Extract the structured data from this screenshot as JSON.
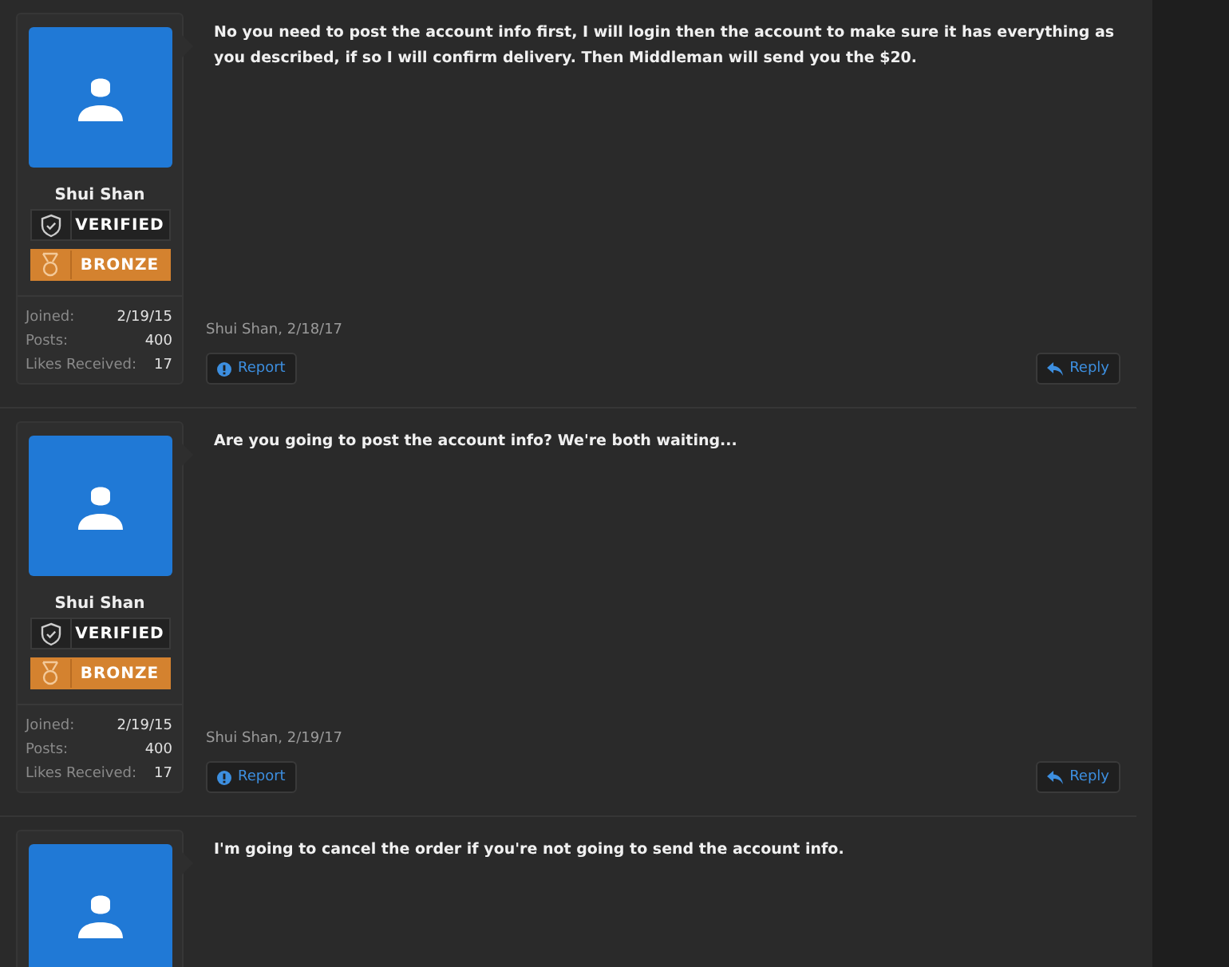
{
  "posts": [
    {
      "user": {
        "name": "Shui Shan",
        "badges": [
          {
            "kind": "verified",
            "label": "VERIFIED"
          },
          {
            "kind": "bronze",
            "label": "BRONZE"
          }
        ],
        "stats": [
          {
            "label": "Joined:",
            "value": "2/19/15"
          },
          {
            "label": "Posts:",
            "value": "400"
          },
          {
            "label": "Likes Received:",
            "value": "17"
          }
        ]
      },
      "message": "No you need to post the account info first, I will login then the account to make sure it has everything as you described, if so I will confirm delivery. Then Middleman will send you the $20.",
      "byline": "Shui Shan, 2/18/17",
      "actions": {
        "report": "Report",
        "reply": "Reply"
      }
    },
    {
      "user": {
        "name": "Shui Shan",
        "badges": [
          {
            "kind": "verified",
            "label": "VERIFIED"
          },
          {
            "kind": "bronze",
            "label": "BRONZE"
          }
        ],
        "stats": [
          {
            "label": "Joined:",
            "value": "2/19/15"
          },
          {
            "label": "Posts:",
            "value": "400"
          },
          {
            "label": "Likes Received:",
            "value": "17"
          }
        ]
      },
      "message": "Are you going to post the account info? We're both waiting...",
      "byline": "Shui Shan, 2/19/17",
      "actions": {
        "report": "Report",
        "reply": "Reply"
      }
    },
    {
      "message": "I'm going to cancel the order if you're not going to send the account info."
    }
  ]
}
